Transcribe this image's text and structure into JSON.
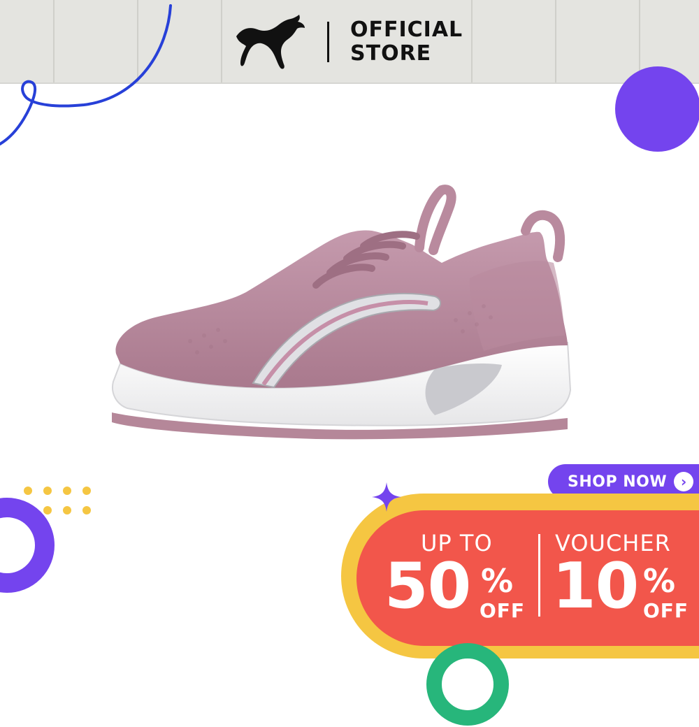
{
  "header": {
    "brand_logo": "puma-cat-logo",
    "store_line1": "OFFICIAL",
    "store_line2": "STORE"
  },
  "product": {
    "image": "pink-running-shoe"
  },
  "cta": {
    "label": "SHOP NOW",
    "icon": "chevron-right-icon",
    "icon_glyph": "›"
  },
  "promo": {
    "left": {
      "prefix": "UP TO",
      "value": "50",
      "percent": "%",
      "suffix": "OFF"
    },
    "right": {
      "prefix": "VOUCHER",
      "value": "10",
      "percent": "%",
      "suffix": "OFF"
    }
  },
  "colors": {
    "header_bg": "#e4e4e0",
    "accent_purple": "#7444ee",
    "promo_yellow": "#f5c642",
    "promo_red": "#f2564b",
    "accent_green": "#27b67b",
    "squiggle_blue": "#2740d8",
    "shoe_pink": "#b78a9d"
  }
}
